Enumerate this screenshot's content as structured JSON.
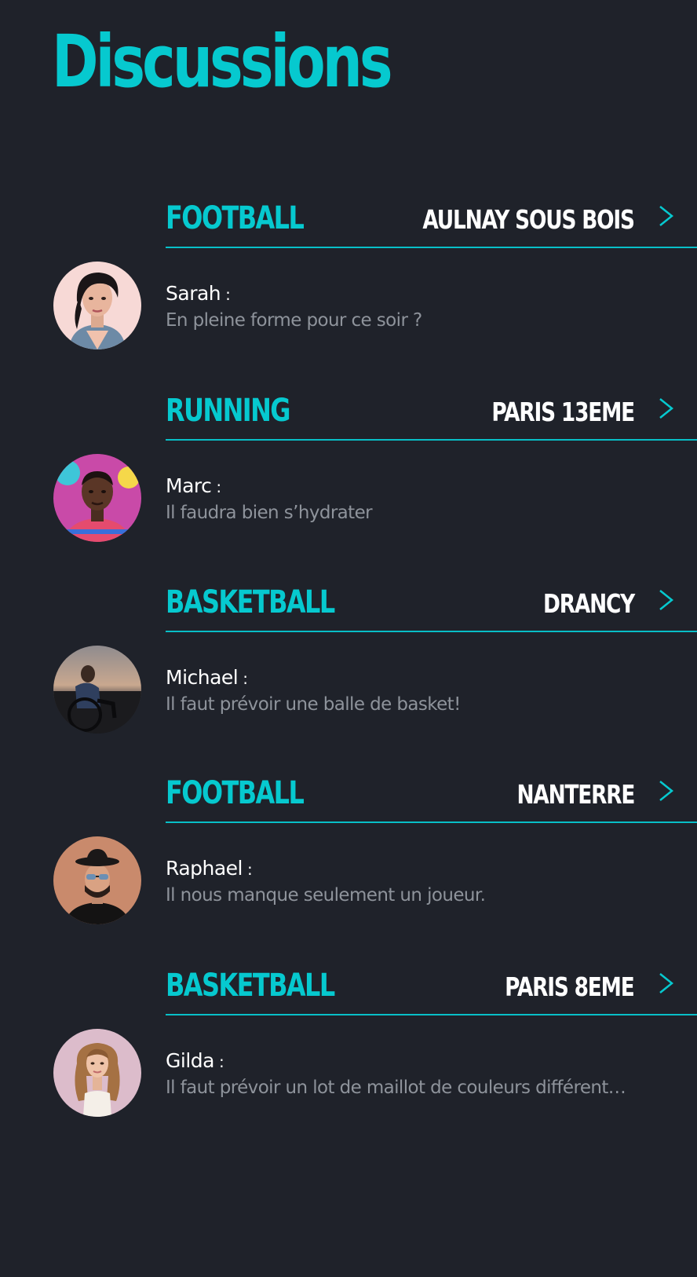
{
  "page": {
    "title": "Discussions"
  },
  "colors": {
    "background": "#1f222a",
    "accent": "#06c9cf",
    "text": "#ffffff",
    "muted": "#8e939b"
  },
  "discussions": [
    {
      "sport": "FOOTBALL",
      "location": "AULNAY SOUS BOIS",
      "icon": "chevron-right-icon",
      "sender": "Sarah",
      "separator": ":",
      "message": "En pleine forme pour ce soir ?"
    },
    {
      "sport": "RUNNING",
      "location": "PARIS 13EME",
      "icon": "chevron-right-icon",
      "sender": "Marc",
      "separator": ":",
      "message": "Il faudra bien s’hydrater"
    },
    {
      "sport": "BASKETBALL",
      "location": "DRANCY",
      "icon": "chevron-right-icon",
      "sender": "Michael",
      "separator": ":",
      "message": "Il faut prévoir une balle de basket!"
    },
    {
      "sport": "FOOTBALL",
      "location": "NANTERRE",
      "icon": "chevron-right-icon",
      "sender": "Raphael",
      "separator": ":",
      "message": "Il nous manque seulement un joueur."
    },
    {
      "sport": "BASKETBALL",
      "location": "PARIS 8EME",
      "icon": "chevron-right-icon",
      "sender": "Gilda",
      "separator": ":",
      "message": "Il faut prévoir un lot de maillot de couleurs différent…"
    }
  ]
}
